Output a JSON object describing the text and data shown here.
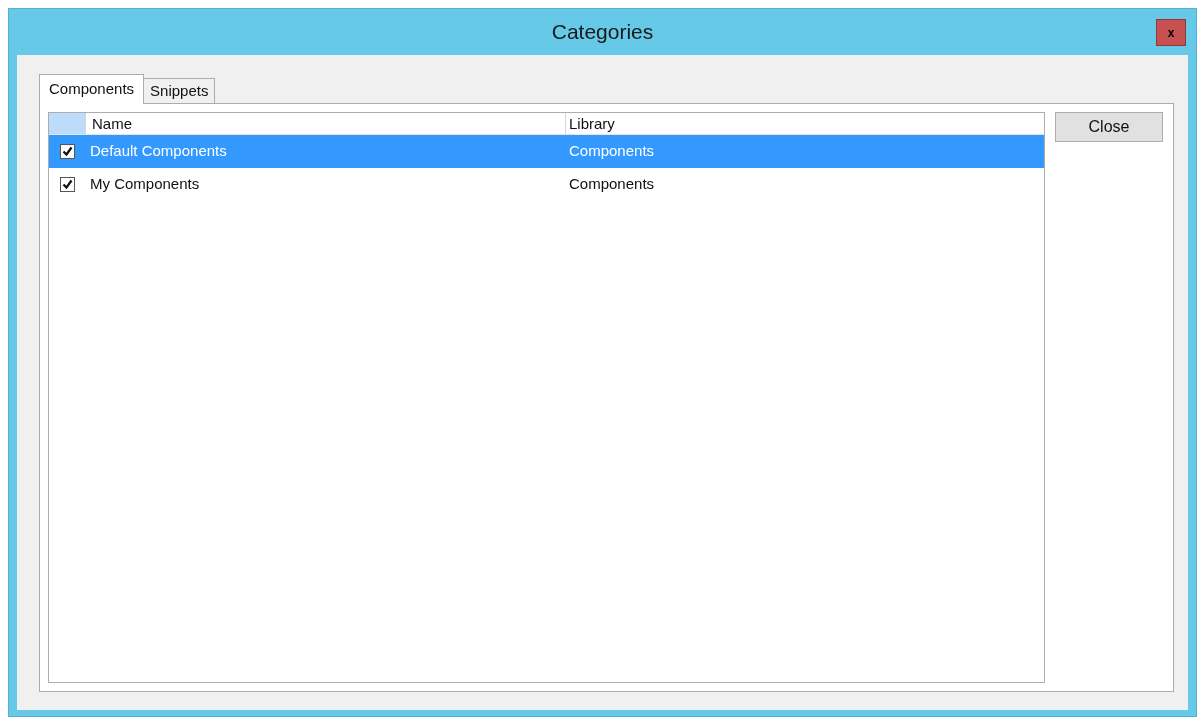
{
  "window": {
    "title": "Categories",
    "close_label": "x"
  },
  "tabs": [
    {
      "label": "Components",
      "selected": true
    },
    {
      "label": "Snippets",
      "selected": false
    }
  ],
  "table": {
    "columns": [
      "Name",
      "Library"
    ],
    "rows": [
      {
        "checked": true,
        "selected": true,
        "cells": [
          "Default Components",
          "Components"
        ]
      },
      {
        "checked": true,
        "selected": false,
        "cells": [
          "My Components",
          "Components"
        ]
      }
    ]
  },
  "buttons": [
    "Close"
  ]
}
